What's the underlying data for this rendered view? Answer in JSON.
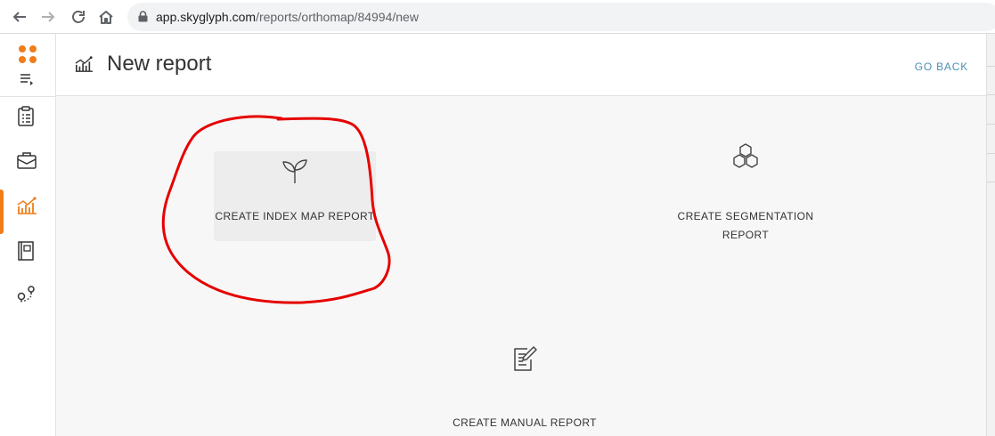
{
  "browser": {
    "url_host": "app.skyglyph.com",
    "url_path": "/reports/orthomap/84994/new",
    "icons": [
      "back-arrow-icon",
      "forward-arrow-icon",
      "reload-icon",
      "home-icon",
      "lock-icon"
    ]
  },
  "sidebar": {
    "logo_icon": "four-dot-logo-icon",
    "menu_toggle_icon": "menu-toggle-icon",
    "items": [
      {
        "icon": "clipboard-icon",
        "active": false
      },
      {
        "icon": "briefcase-icon",
        "active": false
      },
      {
        "icon": "reports-chart-icon",
        "active": true
      },
      {
        "icon": "book-icon",
        "active": false
      },
      {
        "icon": "route-pins-icon",
        "active": false
      }
    ],
    "accent": "#ef7d1a"
  },
  "header": {
    "title": "New report",
    "go_back": "GO BACK",
    "link_color": "#4a8fb3"
  },
  "cards": {
    "index_map": {
      "label": "CREATE INDEX MAP REPORT",
      "icon": "sprout-icon"
    },
    "segmentation": {
      "label_line1": "CREATE SEGMENTATION",
      "label_line2": "REPORT",
      "icon": "hexagon-cluster-icon"
    },
    "manual": {
      "label": "CREATE MANUAL REPORT",
      "icon": "edit-document-icon"
    }
  },
  "annotation": {
    "color": "#e60000"
  }
}
